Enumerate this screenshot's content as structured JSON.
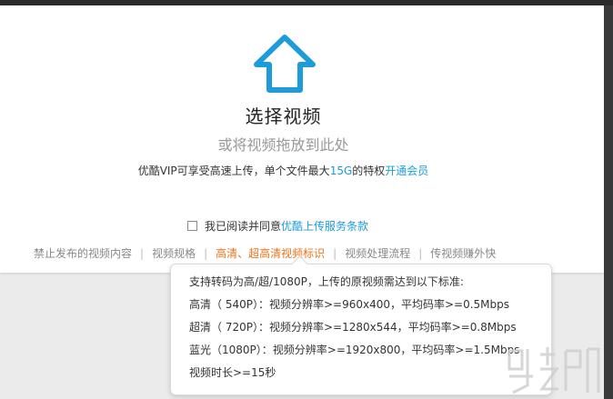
{
  "upload": {
    "title": "选择视频",
    "subtitle": "或将视频拖放到此处",
    "vip_text_before": "优酷VIP可享受高速上传，单个文件最大",
    "vip_size": "15G",
    "vip_text_after": "的特权",
    "vip_link": "开通会员"
  },
  "agreement": {
    "label": "我已阅读并同意",
    "link": "优酷上传服务条款"
  },
  "links": [
    {
      "label": "禁止发布的视频内容",
      "active": false
    },
    {
      "label": "视频规格",
      "active": false
    },
    {
      "label": "高清、超高清视频标识",
      "active": true
    },
    {
      "label": "视频处理流程",
      "active": false
    },
    {
      "label": "传视频赚外快",
      "active": false
    }
  ],
  "tooltip": {
    "lines": [
      "支持转码为高/超/1080P，上传的原视频需达到以下标准:",
      "高清（ 540P）：视频分辨率>=960x400，平均码率>=0.5Mbps",
      "超清（ 720P）：视频分辨率>=1280x544，平均码率>=0.8Mbps",
      "蓝光（1080P）：视频分辨率>=1920x800，平均码率>=1.5Mbps",
      "视频时长>=15秒"
    ]
  },
  "colors": {
    "accent": "#1d9cd9",
    "active_link": "#e8741c"
  },
  "icons": {
    "upload": "upload-arrow-icon"
  }
}
